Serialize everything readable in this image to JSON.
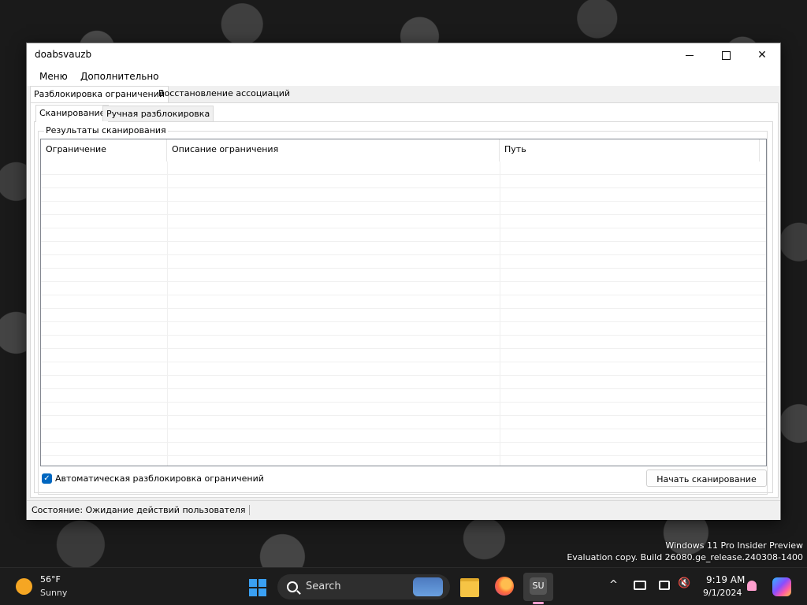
{
  "window": {
    "title": "doabsvauzb",
    "minimize_label": "–",
    "close_label": "✕"
  },
  "menubar": {
    "items": [
      "Меню",
      "Дополнительно"
    ]
  },
  "outer_tabs": [
    {
      "label": "Разблокировка ограничений",
      "active": true
    },
    {
      "label": "Восстановление ассоциаций",
      "active": false
    }
  ],
  "inner_tabs": [
    {
      "label": "Сканирование",
      "active": true
    },
    {
      "label": "Ручная разблокировка",
      "active": false
    }
  ],
  "results": {
    "group_title": "Результаты сканирования",
    "columns": [
      "Ограничение",
      "Описание ограничения",
      "Путь"
    ],
    "rows": []
  },
  "options": {
    "auto_unblock_label": "Автоматическая разблокировка ограничений",
    "auto_unblock_checked": true,
    "checkbox_glyph": "✓"
  },
  "actions": {
    "start_scan_label": "Начать сканирование"
  },
  "statusbar": {
    "text": "Состояние: Ожидание действий пользователя"
  },
  "watermark": {
    "line1": "Windows 11 Pro Insider Preview",
    "line2": "Evaluation copy. Build 26080.ge_release.240308-1400"
  },
  "taskbar": {
    "weather_temp": "56°F",
    "weather_condition": "Sunny",
    "search_label": "Search",
    "app_su_label": "SU",
    "tray_chevron": "^",
    "tray_volume": "🔇",
    "time": "9:19 AM",
    "date": "9/1/2024",
    "accent_color": "#0067c0"
  }
}
